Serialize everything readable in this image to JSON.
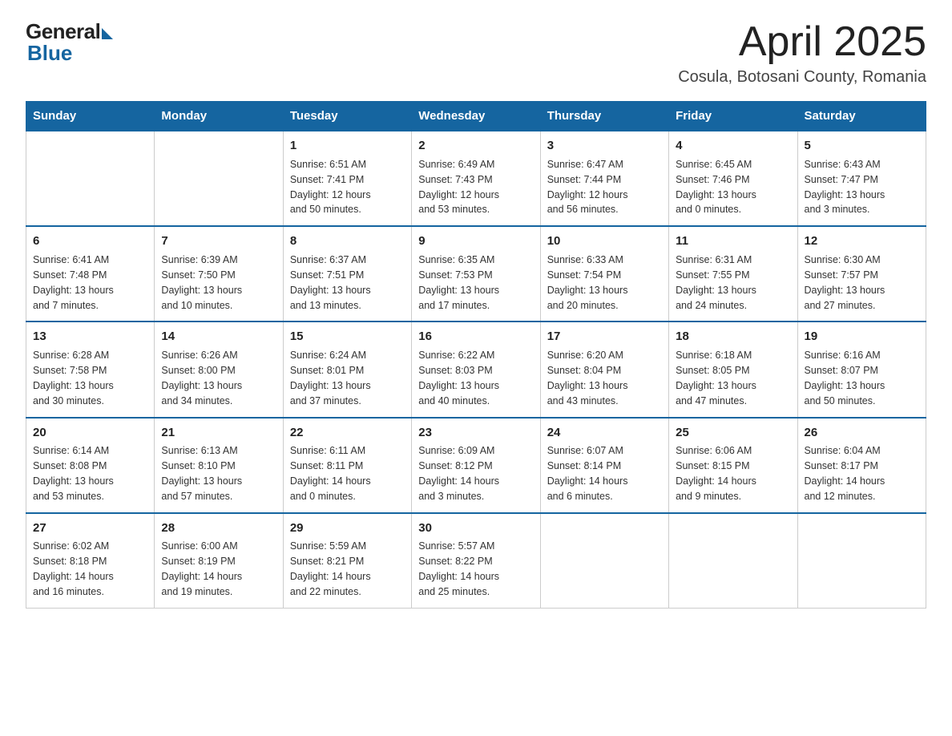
{
  "header": {
    "logo_general": "General",
    "logo_blue": "Blue",
    "title": "April 2025",
    "location": "Cosula, Botosani County, Romania"
  },
  "weekdays": [
    "Sunday",
    "Monday",
    "Tuesday",
    "Wednesday",
    "Thursday",
    "Friday",
    "Saturday"
  ],
  "weeks": [
    [
      {
        "day": "",
        "info": ""
      },
      {
        "day": "",
        "info": ""
      },
      {
        "day": "1",
        "info": "Sunrise: 6:51 AM\nSunset: 7:41 PM\nDaylight: 12 hours\nand 50 minutes."
      },
      {
        "day": "2",
        "info": "Sunrise: 6:49 AM\nSunset: 7:43 PM\nDaylight: 12 hours\nand 53 minutes."
      },
      {
        "day": "3",
        "info": "Sunrise: 6:47 AM\nSunset: 7:44 PM\nDaylight: 12 hours\nand 56 minutes."
      },
      {
        "day": "4",
        "info": "Sunrise: 6:45 AM\nSunset: 7:46 PM\nDaylight: 13 hours\nand 0 minutes."
      },
      {
        "day": "5",
        "info": "Sunrise: 6:43 AM\nSunset: 7:47 PM\nDaylight: 13 hours\nand 3 minutes."
      }
    ],
    [
      {
        "day": "6",
        "info": "Sunrise: 6:41 AM\nSunset: 7:48 PM\nDaylight: 13 hours\nand 7 minutes."
      },
      {
        "day": "7",
        "info": "Sunrise: 6:39 AM\nSunset: 7:50 PM\nDaylight: 13 hours\nand 10 minutes."
      },
      {
        "day": "8",
        "info": "Sunrise: 6:37 AM\nSunset: 7:51 PM\nDaylight: 13 hours\nand 13 minutes."
      },
      {
        "day": "9",
        "info": "Sunrise: 6:35 AM\nSunset: 7:53 PM\nDaylight: 13 hours\nand 17 minutes."
      },
      {
        "day": "10",
        "info": "Sunrise: 6:33 AM\nSunset: 7:54 PM\nDaylight: 13 hours\nand 20 minutes."
      },
      {
        "day": "11",
        "info": "Sunrise: 6:31 AM\nSunset: 7:55 PM\nDaylight: 13 hours\nand 24 minutes."
      },
      {
        "day": "12",
        "info": "Sunrise: 6:30 AM\nSunset: 7:57 PM\nDaylight: 13 hours\nand 27 minutes."
      }
    ],
    [
      {
        "day": "13",
        "info": "Sunrise: 6:28 AM\nSunset: 7:58 PM\nDaylight: 13 hours\nand 30 minutes."
      },
      {
        "day": "14",
        "info": "Sunrise: 6:26 AM\nSunset: 8:00 PM\nDaylight: 13 hours\nand 34 minutes."
      },
      {
        "day": "15",
        "info": "Sunrise: 6:24 AM\nSunset: 8:01 PM\nDaylight: 13 hours\nand 37 minutes."
      },
      {
        "day": "16",
        "info": "Sunrise: 6:22 AM\nSunset: 8:03 PM\nDaylight: 13 hours\nand 40 minutes."
      },
      {
        "day": "17",
        "info": "Sunrise: 6:20 AM\nSunset: 8:04 PM\nDaylight: 13 hours\nand 43 minutes."
      },
      {
        "day": "18",
        "info": "Sunrise: 6:18 AM\nSunset: 8:05 PM\nDaylight: 13 hours\nand 47 minutes."
      },
      {
        "day": "19",
        "info": "Sunrise: 6:16 AM\nSunset: 8:07 PM\nDaylight: 13 hours\nand 50 minutes."
      }
    ],
    [
      {
        "day": "20",
        "info": "Sunrise: 6:14 AM\nSunset: 8:08 PM\nDaylight: 13 hours\nand 53 minutes."
      },
      {
        "day": "21",
        "info": "Sunrise: 6:13 AM\nSunset: 8:10 PM\nDaylight: 13 hours\nand 57 minutes."
      },
      {
        "day": "22",
        "info": "Sunrise: 6:11 AM\nSunset: 8:11 PM\nDaylight: 14 hours\nand 0 minutes."
      },
      {
        "day": "23",
        "info": "Sunrise: 6:09 AM\nSunset: 8:12 PM\nDaylight: 14 hours\nand 3 minutes."
      },
      {
        "day": "24",
        "info": "Sunrise: 6:07 AM\nSunset: 8:14 PM\nDaylight: 14 hours\nand 6 minutes."
      },
      {
        "day": "25",
        "info": "Sunrise: 6:06 AM\nSunset: 8:15 PM\nDaylight: 14 hours\nand 9 minutes."
      },
      {
        "day": "26",
        "info": "Sunrise: 6:04 AM\nSunset: 8:17 PM\nDaylight: 14 hours\nand 12 minutes."
      }
    ],
    [
      {
        "day": "27",
        "info": "Sunrise: 6:02 AM\nSunset: 8:18 PM\nDaylight: 14 hours\nand 16 minutes."
      },
      {
        "day": "28",
        "info": "Sunrise: 6:00 AM\nSunset: 8:19 PM\nDaylight: 14 hours\nand 19 minutes."
      },
      {
        "day": "29",
        "info": "Sunrise: 5:59 AM\nSunset: 8:21 PM\nDaylight: 14 hours\nand 22 minutes."
      },
      {
        "day": "30",
        "info": "Sunrise: 5:57 AM\nSunset: 8:22 PM\nDaylight: 14 hours\nand 25 minutes."
      },
      {
        "day": "",
        "info": ""
      },
      {
        "day": "",
        "info": ""
      },
      {
        "day": "",
        "info": ""
      }
    ]
  ]
}
